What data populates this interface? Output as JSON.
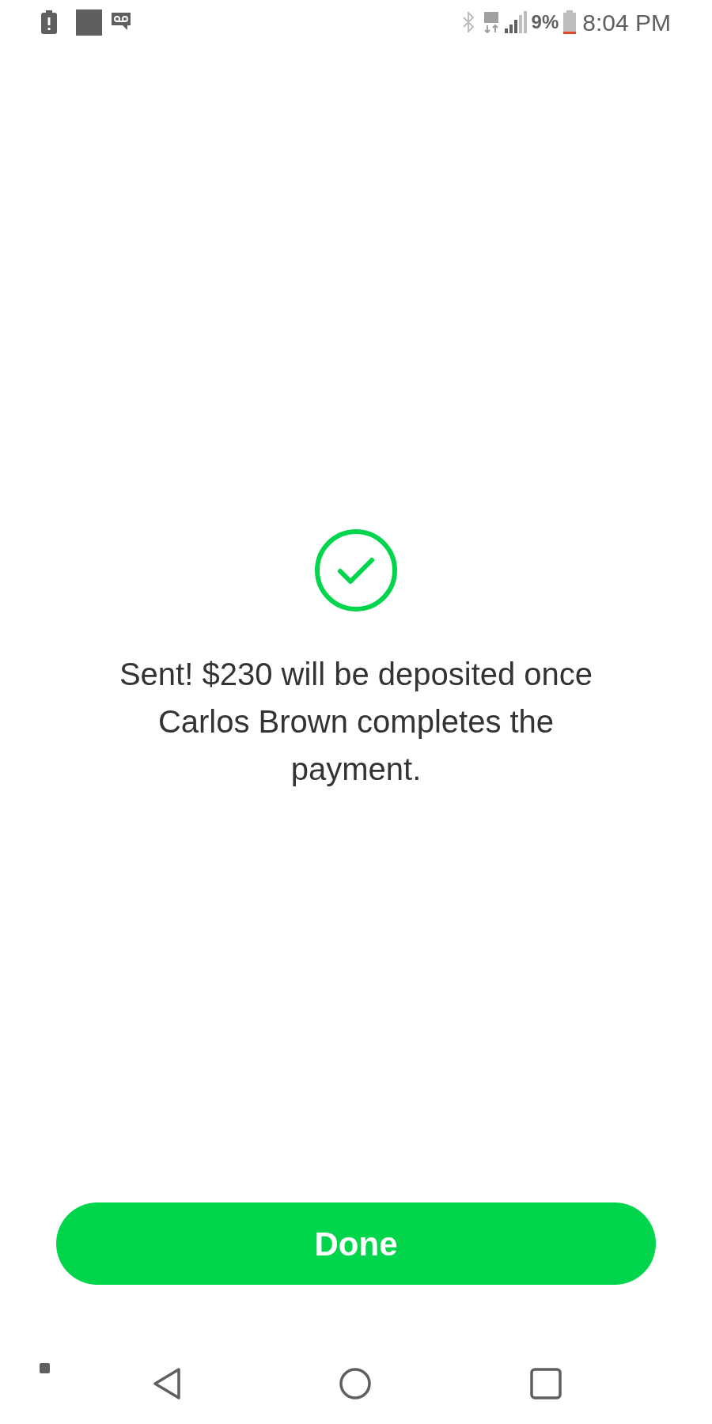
{
  "status_bar": {
    "battery_percent": "9%",
    "time": "8:04 PM"
  },
  "message": "Sent! $230 will be deposited once Carlos Brown completes the payment.",
  "done_button": {
    "label": "Done"
  }
}
